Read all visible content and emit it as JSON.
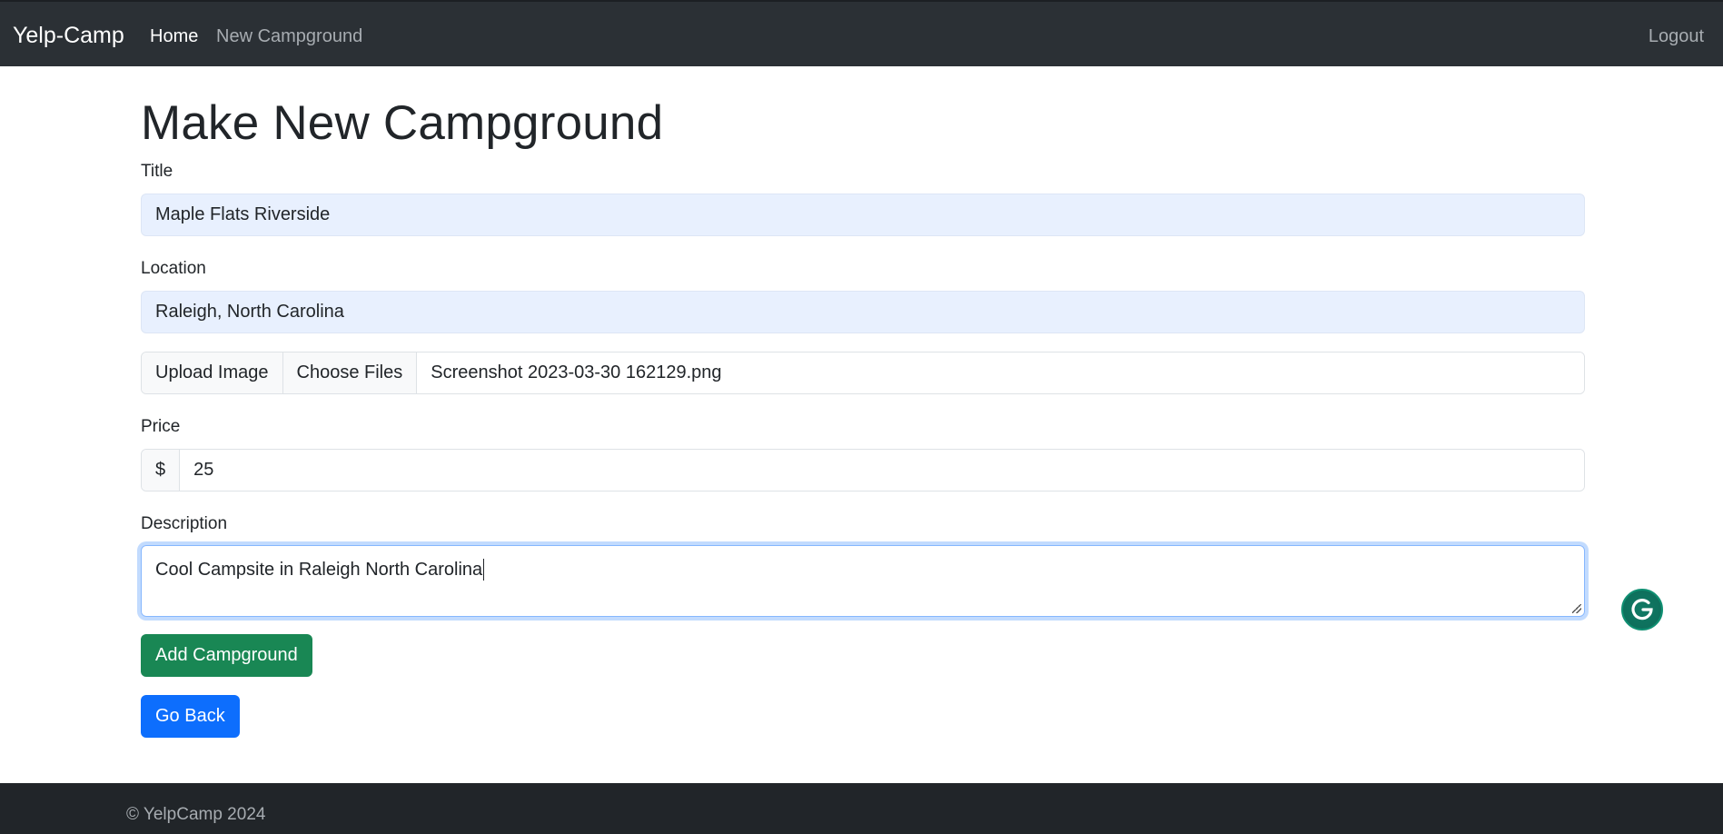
{
  "navbar": {
    "brand": "Yelp-Camp",
    "home": "Home",
    "new_campground": "New Campground",
    "logout": "Logout"
  },
  "page": {
    "title": "Make New Campground"
  },
  "form": {
    "title_label": "Title",
    "title_value": "Maple Flats Riverside",
    "location_label": "Location",
    "location_value": "Raleigh, North Carolina",
    "upload_label": "Upload Image",
    "choose_files_label": "Choose Files",
    "file_name": "Screenshot 2023-03-30 162129.png",
    "price_label": "Price",
    "currency_symbol": "$",
    "price_value": "25",
    "description_label": "Description",
    "description_value": "Cool Campsite in Raleigh North Carolina",
    "submit_label": "Add Campground",
    "back_label": "Go Back"
  },
  "footer": {
    "text": "© YelpCamp 2024"
  },
  "colors": {
    "navbar_bg": "#2b3035",
    "success": "#198754",
    "primary": "#0d6efd",
    "autofill_bg": "#e8f0fe"
  },
  "icons": {
    "grammarly": "grammarly-icon"
  }
}
